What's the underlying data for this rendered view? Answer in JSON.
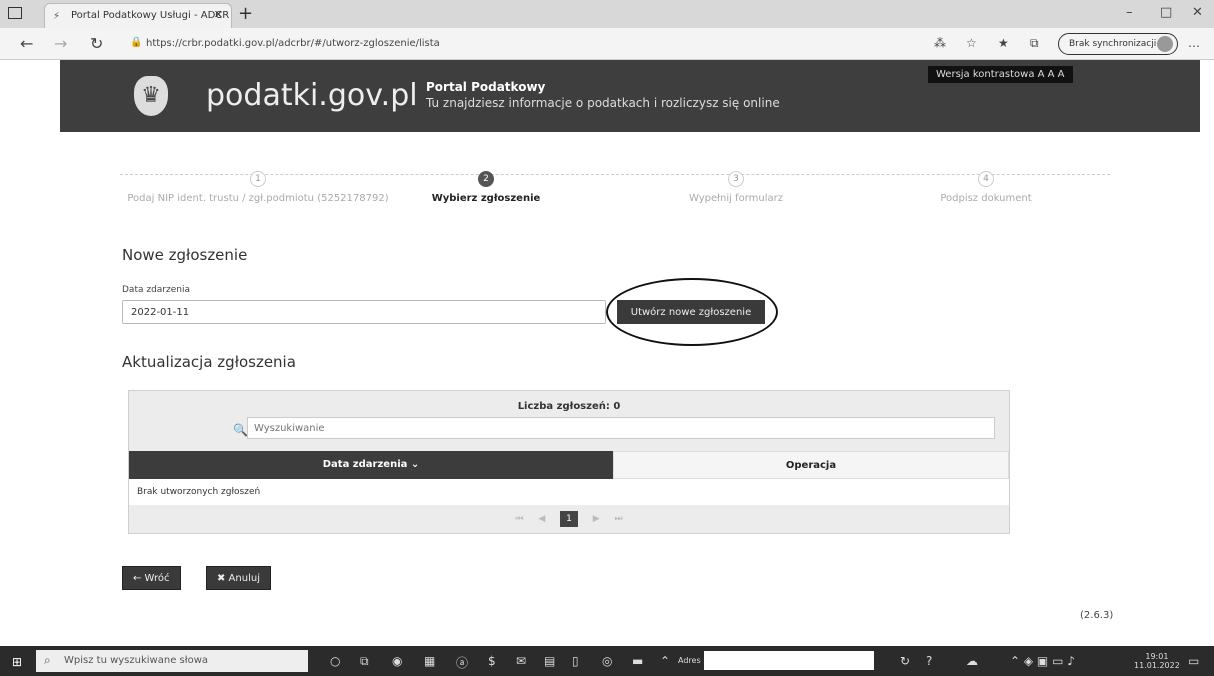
{
  "browser": {
    "tab_title": "Portal Podatkowy Usługi - ADCR",
    "new_tab": "+",
    "url": "https://crbr.podatki.gov.pl/adcrbr/#/utworz-zgloszenie/lista",
    "sync_label": "Brak synchronizacji"
  },
  "header": {
    "logo_text": "podatki.gov.pl",
    "portal_title": "Portal Podatkowy",
    "portal_subtitle": "Tu znajdziesz informacje o podatkach i rozliczysz się online",
    "contrast": "Wersja kontrastowa A A A"
  },
  "steps": [
    {
      "num": "1",
      "label": "Podaj NIP ident. trustu / zgł.podmiotu (5252178792)"
    },
    {
      "num": "2",
      "label": "Wybierz zgłoszenie"
    },
    {
      "num": "3",
      "label": "Wypełnij formularz"
    },
    {
      "num": "4",
      "label": "Podpisz dokument"
    }
  ],
  "new_section": {
    "title": "Nowe zgłoszenie",
    "date_label": "Data zdarzenia",
    "date_value": "2022-01-11",
    "create_button": "Utwórz nowe zgłoszenie"
  },
  "update_section": {
    "title": "Aktualizacja zgłoszenia",
    "count": "Liczba zgłoszeń: 0",
    "search_placeholder": "Wyszukiwanie",
    "col_date": "Data zdarzenia ⌄",
    "col_operation": "Operacja",
    "empty_text": "Brak utworzonych zgłoszeń",
    "pager": [
      "⏮",
      "◀",
      "1",
      "▶",
      "⏭"
    ]
  },
  "actions": {
    "back": "← Wróć",
    "cancel": "✖ Anuluj"
  },
  "version": "(2.6.3)",
  "taskbar": {
    "search_placeholder": "Wpisz tu wyszukiwane słowa",
    "address_label": "Adres",
    "time": "19:01",
    "date": "11.01.2022"
  }
}
